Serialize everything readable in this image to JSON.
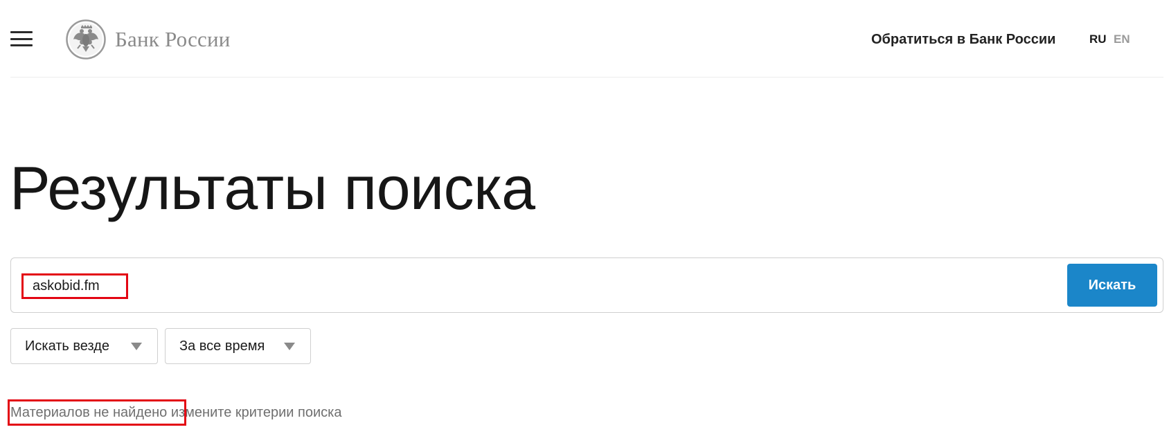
{
  "header": {
    "logo_text": "Банк России",
    "contact_link": "Обратиться в Банк России",
    "lang_ru": "RU",
    "lang_en": "EN"
  },
  "main": {
    "title": "Результаты поиска",
    "search": {
      "query": "askobid.fm",
      "button_label": "Искать"
    },
    "filters": {
      "scope": "Искать везде",
      "period": "За все время"
    },
    "result": {
      "not_found": "Материалов не найдено",
      "hint": "измените критерии поиска"
    }
  },
  "colors": {
    "accent": "#1b86c9",
    "highlight": "#e30613",
    "muted_text": "#6f6f6f"
  },
  "icons": {
    "menu": "hamburger-menu-icon",
    "emblem": "double-headed-eagle-emblem-icon",
    "dropdown": "triangle-down-icon"
  }
}
